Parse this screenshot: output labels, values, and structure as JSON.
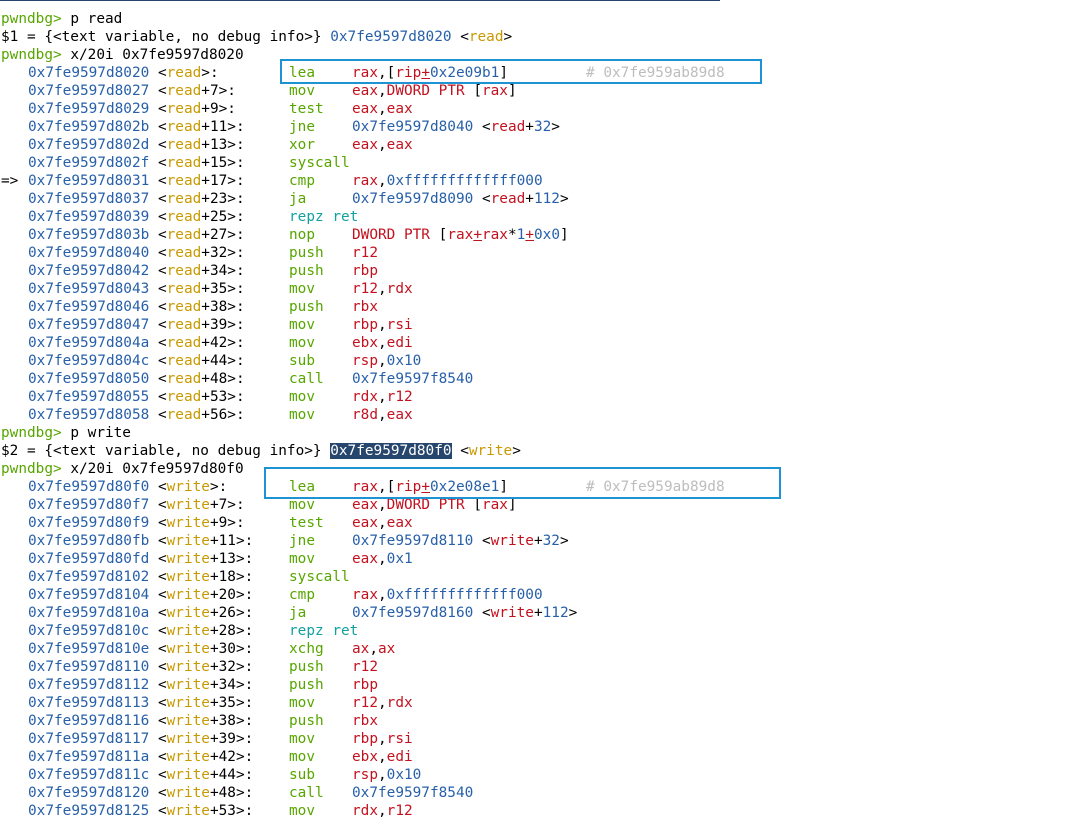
{
  "app": "pwndbg",
  "prompt": "pwndbg>",
  "colors": {
    "prompt": "#57a600",
    "address": "#2760a9",
    "symbol": "#c99a00",
    "mnemonic": "#57a600",
    "register": "#c3121f",
    "immediate": "#2760a9",
    "comment": "#bdbdbd",
    "highlight_box": "#1e93d3",
    "selection": "#27466d"
  },
  "current_instruction_marker": "=>",
  "blocks": [
    {
      "command": "p read",
      "print_result": {
        "prefix": "$1 = {<text variable, no debug info>} ",
        "address": "0x7fe9597d8020",
        "symbol": "read",
        "selected": false
      },
      "examine_command": "x/20i 0x7fe9597d8020",
      "instructions": [
        {
          "address": "0x7fe9597d8020",
          "symbol": "read",
          "offset": "",
          "mnemonic": "lea",
          "operands": [
            [
              "reg",
              "rax"
            ],
            [
              "p",
              ","
            ],
            [
              "p",
              "["
            ],
            [
              "reg",
              "rip"
            ],
            [
              "plus",
              "+"
            ],
            [
              "imm",
              "0x2e09b1"
            ],
            [
              "p",
              "]"
            ]
          ],
          "comment": "# 0x7fe959ab89d8"
        },
        {
          "address": "0x7fe9597d8027",
          "symbol": "read",
          "offset": "+7",
          "mnemonic": "mov",
          "operands": [
            [
              "reg",
              "eax"
            ],
            [
              "p",
              ","
            ],
            [
              "reg",
              "DWORD PTR "
            ],
            [
              "p",
              "["
            ],
            [
              "reg",
              "rax"
            ],
            [
              "p",
              "]"
            ]
          ]
        },
        {
          "address": "0x7fe9597d8029",
          "symbol": "read",
          "offset": "+9",
          "mnemonic": "test",
          "operands": [
            [
              "reg",
              "eax"
            ],
            [
              "p",
              ","
            ],
            [
              "reg",
              "eax"
            ]
          ]
        },
        {
          "address": "0x7fe9597d802b",
          "symbol": "read",
          "offset": "+11",
          "mnemonic": "jne",
          "operands": [
            [
              "imm",
              "0x7fe9597d8040"
            ],
            [
              "p",
              " <"
            ],
            [
              "reg",
              "read"
            ],
            [
              "p",
              "+"
            ],
            [
              "imm",
              "32"
            ],
            [
              "p",
              ">"
            ]
          ]
        },
        {
          "address": "0x7fe9597d802d",
          "symbol": "read",
          "offset": "+13",
          "mnemonic": "xor",
          "operands": [
            [
              "reg",
              "eax"
            ],
            [
              "p",
              ","
            ],
            [
              "reg",
              "eax"
            ]
          ]
        },
        {
          "address": "0x7fe9597d802f",
          "symbol": "read",
          "offset": "+15",
          "mnemonic": "syscall",
          "operands": []
        },
        {
          "address": "0x7fe9597d8031",
          "symbol": "read",
          "offset": "+17",
          "mnemonic": "cmp",
          "current": true,
          "operands": [
            [
              "reg",
              "rax"
            ],
            [
              "p",
              ","
            ],
            [
              "imm",
              "0xfffffffffffff000"
            ]
          ]
        },
        {
          "address": "0x7fe9597d8037",
          "symbol": "read",
          "offset": "+23",
          "mnemonic": "ja",
          "operands": [
            [
              "imm",
              "0x7fe9597d8090"
            ],
            [
              "p",
              " <"
            ],
            [
              "reg",
              "read"
            ],
            [
              "p",
              "+"
            ],
            [
              "imm",
              "112"
            ],
            [
              "p",
              ">"
            ]
          ]
        },
        {
          "address": "0x7fe9597d8039",
          "symbol": "read",
          "offset": "+25",
          "mnemonic": "repz ret",
          "cmnemonic": true,
          "operands": []
        },
        {
          "address": "0x7fe9597d803b",
          "symbol": "read",
          "offset": "+27",
          "mnemonic": "nop",
          "operands": [
            [
              "reg",
              "DWORD PTR "
            ],
            [
              "p",
              "["
            ],
            [
              "reg",
              "rax"
            ],
            [
              "plus",
              "+"
            ],
            [
              "reg",
              "rax"
            ],
            [
              "p",
              "*"
            ],
            [
              "imm",
              "1"
            ],
            [
              "plus",
              "+"
            ],
            [
              "imm",
              "0x0"
            ],
            [
              "p",
              "]"
            ]
          ]
        },
        {
          "address": "0x7fe9597d8040",
          "symbol": "read",
          "offset": "+32",
          "mnemonic": "push",
          "operands": [
            [
              "reg",
              "r12"
            ]
          ]
        },
        {
          "address": "0x7fe9597d8042",
          "symbol": "read",
          "offset": "+34",
          "mnemonic": "push",
          "operands": [
            [
              "reg",
              "rbp"
            ]
          ]
        },
        {
          "address": "0x7fe9597d8043",
          "symbol": "read",
          "offset": "+35",
          "mnemonic": "mov",
          "operands": [
            [
              "reg",
              "r12"
            ],
            [
              "p",
              ","
            ],
            [
              "reg",
              "rdx"
            ]
          ]
        },
        {
          "address": "0x7fe9597d8046",
          "symbol": "read",
          "offset": "+38",
          "mnemonic": "push",
          "operands": [
            [
              "reg",
              "rbx"
            ]
          ]
        },
        {
          "address": "0x7fe9597d8047",
          "symbol": "read",
          "offset": "+39",
          "mnemonic": "mov",
          "operands": [
            [
              "reg",
              "rbp"
            ],
            [
              "p",
              ","
            ],
            [
              "reg",
              "rsi"
            ]
          ]
        },
        {
          "address": "0x7fe9597d804a",
          "symbol": "read",
          "offset": "+42",
          "mnemonic": "mov",
          "operands": [
            [
              "reg",
              "ebx"
            ],
            [
              "p",
              ","
            ],
            [
              "reg",
              "edi"
            ]
          ]
        },
        {
          "address": "0x7fe9597d804c",
          "symbol": "read",
          "offset": "+44",
          "mnemonic": "sub",
          "operands": [
            [
              "reg",
              "rsp"
            ],
            [
              "p",
              ","
            ],
            [
              "imm",
              "0x10"
            ]
          ]
        },
        {
          "address": "0x7fe9597d8050",
          "symbol": "read",
          "offset": "+48",
          "mnemonic": "call",
          "operands": [
            [
              "imm",
              "0x7fe9597f8540"
            ]
          ]
        },
        {
          "address": "0x7fe9597d8055",
          "symbol": "read",
          "offset": "+53",
          "mnemonic": "mov",
          "operands": [
            [
              "reg",
              "rdx"
            ],
            [
              "p",
              ","
            ],
            [
              "reg",
              "r12"
            ]
          ]
        },
        {
          "address": "0x7fe9597d8058",
          "symbol": "read",
          "offset": "+56",
          "mnemonic": "mov",
          "operands": [
            [
              "reg",
              "r8d"
            ],
            [
              "p",
              ","
            ],
            [
              "reg",
              "eax"
            ]
          ]
        }
      ]
    },
    {
      "command": "p write",
      "print_result": {
        "prefix": "$2 = {<text variable, no debug info>} ",
        "address": "0x7fe9597d80f0",
        "symbol": "write",
        "selected": true
      },
      "examine_command": "x/20i 0x7fe9597d80f0",
      "instructions": [
        {
          "address": "0x7fe9597d80f0",
          "symbol": "write",
          "offset": "",
          "mnemonic": "lea",
          "operands": [
            [
              "reg",
              "rax"
            ],
            [
              "p",
              ","
            ],
            [
              "p",
              "["
            ],
            [
              "reg",
              "rip"
            ],
            [
              "plus",
              "+"
            ],
            [
              "imm",
              "0x2e08e1"
            ],
            [
              "p",
              "]"
            ]
          ],
          "comment": "# 0x7fe959ab89d8"
        },
        {
          "address": "0x7fe9597d80f7",
          "symbol": "write",
          "offset": "+7",
          "mnemonic": "mov",
          "operands": [
            [
              "reg",
              "eax"
            ],
            [
              "p",
              ","
            ],
            [
              "reg",
              "DWORD PTR "
            ],
            [
              "p",
              "["
            ],
            [
              "reg",
              "rax"
            ],
            [
              "p",
              "]"
            ]
          ]
        },
        {
          "address": "0x7fe9597d80f9",
          "symbol": "write",
          "offset": "+9",
          "mnemonic": "test",
          "operands": [
            [
              "reg",
              "eax"
            ],
            [
              "p",
              ","
            ],
            [
              "reg",
              "eax"
            ]
          ]
        },
        {
          "address": "0x7fe9597d80fb",
          "symbol": "write",
          "offset": "+11",
          "mnemonic": "jne",
          "operands": [
            [
              "imm",
              "0x7fe9597d8110"
            ],
            [
              "p",
              " <"
            ],
            [
              "reg",
              "write"
            ],
            [
              "p",
              "+"
            ],
            [
              "imm",
              "32"
            ],
            [
              "p",
              ">"
            ]
          ]
        },
        {
          "address": "0x7fe9597d80fd",
          "symbol": "write",
          "offset": "+13",
          "mnemonic": "mov",
          "operands": [
            [
              "reg",
              "eax"
            ],
            [
              "p",
              ","
            ],
            [
              "imm",
              "0x1"
            ]
          ]
        },
        {
          "address": "0x7fe9597d8102",
          "symbol": "write",
          "offset": "+18",
          "mnemonic": "syscall",
          "operands": []
        },
        {
          "address": "0x7fe9597d8104",
          "symbol": "write",
          "offset": "+20",
          "mnemonic": "cmp",
          "operands": [
            [
              "reg",
              "rax"
            ],
            [
              "p",
              ","
            ],
            [
              "imm",
              "0xfffffffffffff000"
            ]
          ]
        },
        {
          "address": "0x7fe9597d810a",
          "symbol": "write",
          "offset": "+26",
          "mnemonic": "ja",
          "operands": [
            [
              "imm",
              "0x7fe9597d8160"
            ],
            [
              "p",
              " <"
            ],
            [
              "reg",
              "write"
            ],
            [
              "p",
              "+"
            ],
            [
              "imm",
              "112"
            ],
            [
              "p",
              ">"
            ]
          ]
        },
        {
          "address": "0x7fe9597d810c",
          "symbol": "write",
          "offset": "+28",
          "mnemonic": "repz ret",
          "cmnemonic": true,
          "operands": []
        },
        {
          "address": "0x7fe9597d810e",
          "symbol": "write",
          "offset": "+30",
          "mnemonic": "xchg",
          "operands": [
            [
              "reg",
              "ax"
            ],
            [
              "p",
              ","
            ],
            [
              "reg",
              "ax"
            ]
          ]
        },
        {
          "address": "0x7fe9597d8110",
          "symbol": "write",
          "offset": "+32",
          "mnemonic": "push",
          "operands": [
            [
              "reg",
              "r12"
            ]
          ]
        },
        {
          "address": "0x7fe9597d8112",
          "symbol": "write",
          "offset": "+34",
          "mnemonic": "push",
          "operands": [
            [
              "reg",
              "rbp"
            ]
          ]
        },
        {
          "address": "0x7fe9597d8113",
          "symbol": "write",
          "offset": "+35",
          "mnemonic": "mov",
          "operands": [
            [
              "reg",
              "r12"
            ],
            [
              "p",
              ","
            ],
            [
              "reg",
              "rdx"
            ]
          ]
        },
        {
          "address": "0x7fe9597d8116",
          "symbol": "write",
          "offset": "+38",
          "mnemonic": "push",
          "operands": [
            [
              "reg",
              "rbx"
            ]
          ]
        },
        {
          "address": "0x7fe9597d8117",
          "symbol": "write",
          "offset": "+39",
          "mnemonic": "mov",
          "operands": [
            [
              "reg",
              "rbp"
            ],
            [
              "p",
              ","
            ],
            [
              "reg",
              "rsi"
            ]
          ]
        },
        {
          "address": "0x7fe9597d811a",
          "symbol": "write",
          "offset": "+42",
          "mnemonic": "mov",
          "operands": [
            [
              "reg",
              "ebx"
            ],
            [
              "p",
              ","
            ],
            [
              "reg",
              "edi"
            ]
          ]
        },
        {
          "address": "0x7fe9597d811c",
          "symbol": "write",
          "offset": "+44",
          "mnemonic": "sub",
          "operands": [
            [
              "reg",
              "rsp"
            ],
            [
              "p",
              ","
            ],
            [
              "imm",
              "0x10"
            ]
          ]
        },
        {
          "address": "0x7fe9597d8120",
          "symbol": "write",
          "offset": "+48",
          "mnemonic": "call",
          "operands": [
            [
              "imm",
              "0x7fe9597f8540"
            ]
          ]
        },
        {
          "address": "0x7fe9597d8125",
          "symbol": "write",
          "offset": "+53",
          "mnemonic": "mov",
          "operands": [
            [
              "reg",
              "rdx"
            ],
            [
              "p",
              ","
            ],
            [
              "reg",
              "r12"
            ]
          ]
        }
      ]
    }
  ]
}
